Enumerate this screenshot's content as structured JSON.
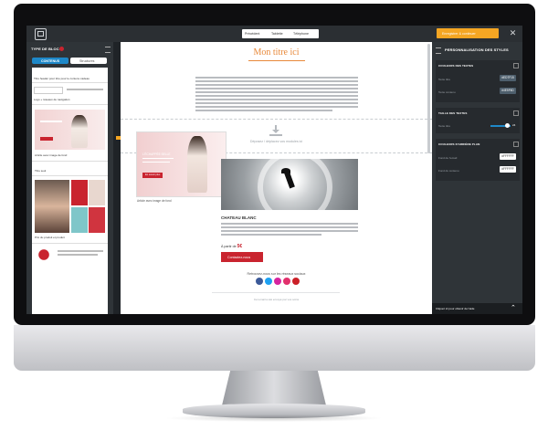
{
  "toolbar": {
    "undo_label": "Précédent",
    "desktop_label": "Tablette",
    "mobile_label": "Téléphone",
    "save_label": "Enregistrer & continuer"
  },
  "left_panel": {
    "title": "TYPE DE BLOC",
    "tabs": [
      "CONTENUS",
      "Structures"
    ],
    "block_items": [
      "Titre header pour titre pour le contenu cadeau",
      "Logo + réseaux de navigation",
      "Article avec image de fond",
      "Titre seul",
      "Prix du produit et produit"
    ]
  },
  "email": {
    "title": "Mon titre ici",
    "drop_hint": "Déposez / déplacez vos modules ici",
    "moved_caption": "Article avec image de fond",
    "moved_title": "L'ÉCHAPPÉE BELLE",
    "moved_btn": "En savoir plus",
    "section_title": "CHATEAU BLANC",
    "price_text": "À partir de ",
    "price_value": "5€",
    "cta_label": "Contactez-nous",
    "social_text": "Retrouvez-nous sur les réseaux sociaux",
    "footer_text": "Cet email a été envoyé par vos soins"
  },
  "right_panel": {
    "title": "PERSONNALISATION DES STYLES",
    "sections": [
      {
        "title": "COULEURS DES TEXTES",
        "rows": [
          {
            "label": "Texte titre",
            "value": "#ED7F15"
          },
          {
            "label": "Texte contenu",
            "value": "#4E5F6D"
          }
        ]
      },
      {
        "title": "TAILLE DES TEXTES",
        "rows": [
          {
            "label": "Texte titre",
            "value": "24"
          }
        ]
      },
      {
        "title": "COULEURS D'ARRIÈRE PLAN",
        "rows": [
          {
            "label": "Fond de l'email",
            "value": "#FFFFFF"
          },
          {
            "label": "Fond du contenu",
            "value": "#FFFFFF"
          }
        ]
      }
    ],
    "footer_help": "Cliquez ici pour obtenir de l'aide"
  },
  "colors": {
    "accent_orange": "#f5a623",
    "title_orange": "#e8893a",
    "cta_red": "#c9242f",
    "tab_blue": "#1e88c8",
    "social": [
      "#3b5998",
      "#1da1f2",
      "#d6249f",
      "#e1306c",
      "#cb2027"
    ]
  },
  "icons": [
    "logo-icon",
    "close-icon",
    "upload-icon",
    "arrow-right-icon",
    "menu-icon",
    "chevron-up-icon"
  ]
}
